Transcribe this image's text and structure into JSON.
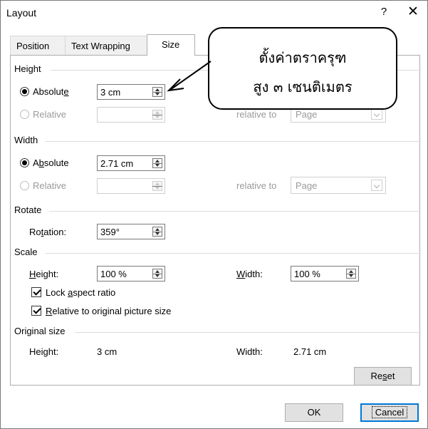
{
  "window": {
    "title": "Layout",
    "help_label": "?",
    "close_label": "✕"
  },
  "tabs": [
    {
      "label": "Position"
    },
    {
      "label": "Text Wrapping"
    },
    {
      "label": "Size"
    }
  ],
  "height_group": {
    "label": "Height",
    "absolute_label_pre": "Absolut",
    "absolute_label_acc": "e",
    "absolute_value": "3 cm",
    "relative_label": "Relative",
    "relative_to_label": "relative to",
    "relative_to_value": "Page"
  },
  "width_group": {
    "label": "Width",
    "absolute_label_pre": "A",
    "absolute_label_acc": "b",
    "absolute_label_post": "solute",
    "absolute_value": "2.71 cm",
    "relative_label": "Relative",
    "relative_to_label": "relative to",
    "relative_to_value": "Page"
  },
  "rotate_group": {
    "label": "Rotate",
    "rotation_label_pre": "Ro",
    "rotation_label_acc": "t",
    "rotation_label_post": "ation:",
    "rotation_value": "359°"
  },
  "scale_group": {
    "label": "Scale",
    "height_label_acc": "H",
    "height_label_post": "eight:",
    "height_value": "100 %",
    "width_label_acc": "W",
    "width_label_post": "idth:",
    "width_value": "100 %",
    "lock_label_pre": "Lock ",
    "lock_label_acc": "a",
    "lock_label_post": "spect ratio",
    "relative_label_acc": "R",
    "relative_label_post": "elative to original picture size"
  },
  "original_group": {
    "label": "Original size",
    "height_label": "Height:",
    "height_value": "3 cm",
    "width_label": "Width:",
    "width_value": "2.71 cm",
    "reset_pre": "Re",
    "reset_acc": "s",
    "reset_post": "et"
  },
  "footer": {
    "ok_label": "OK",
    "cancel_label": "Cancel"
  },
  "callout": {
    "line1": "ตั้งค่าตราครุฑ",
    "line2": "สูง ๓ เซนติเมตร"
  }
}
